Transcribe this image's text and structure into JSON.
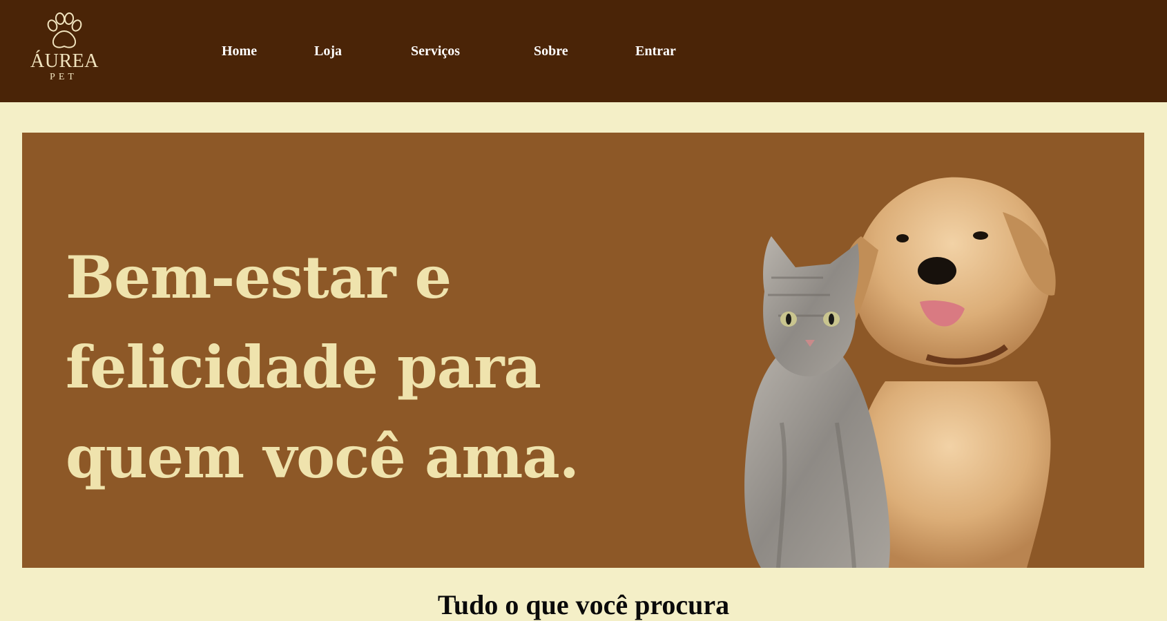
{
  "brand": {
    "name": "ÁUREA",
    "tagline": "PET"
  },
  "nav": [
    {
      "label": "Home"
    },
    {
      "label": "Loja"
    },
    {
      "label": "Serviços"
    },
    {
      "label": "Sobre"
    },
    {
      "label": "Entrar"
    }
  ],
  "hero": {
    "headline_lines": [
      "Bem-estar e",
      "felicidade para",
      "quem você ama."
    ]
  },
  "section": {
    "title": "Tudo o que você procura"
  },
  "colors": {
    "header_bg": "#4a2407",
    "page_bg": "#f4efc7",
    "hero_bg": "#8d5827",
    "headline": "#efe3ad"
  }
}
